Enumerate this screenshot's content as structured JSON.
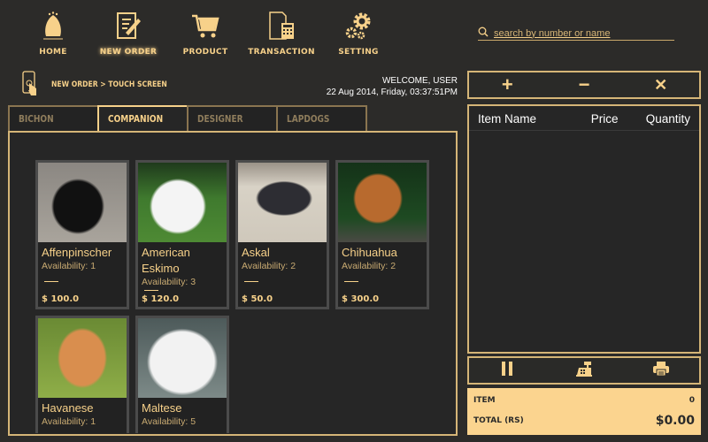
{
  "nav": [
    {
      "label": "HOME",
      "icon": "home-icon"
    },
    {
      "label": "NEW ORDER",
      "icon": "new-order-icon"
    },
    {
      "label": "PRODUCT",
      "icon": "cart-icon"
    },
    {
      "label": "TRANSACTION",
      "icon": "calculator-icon"
    },
    {
      "label": "SETTING",
      "icon": "gear-icon"
    }
  ],
  "search": {
    "placeholder": "search by number or name"
  },
  "breadcrumb": "NEW ORDER > TOUCH SCREEN",
  "welcome": "WELCOME, USER",
  "datetime": "22 Aug 2014, Friday, 03:37:51PM",
  "tabs": [
    "BICHON",
    "COMPANION",
    "DESIGNER",
    "LAPDOGS"
  ],
  "products": [
    {
      "name": "Affenpinscher",
      "availability": "Availability: 1",
      "price": "$  100.0"
    },
    {
      "name": "American Eskimo",
      "availability": "Availability: 3",
      "price": "$  120.0"
    },
    {
      "name": "Askal",
      "availability": "Availability: 2",
      "price": "$  50.0"
    },
    {
      "name": "Chihuahua",
      "availability": "Availability: 2",
      "price": "$  300.0"
    },
    {
      "name": "Havanese",
      "availability": "Availability: 1",
      "price": ""
    },
    {
      "name": "Maltese",
      "availability": "Availability: 5",
      "price": ""
    }
  ],
  "cart": {
    "plus": "+",
    "minus": "−",
    "remove": "✕",
    "columns": [
      "Item Name",
      "Price",
      "Quantity"
    ]
  },
  "summary": {
    "item_label": "ITEM",
    "item_value": "0",
    "total_label": "TOTAL (RS)",
    "total_value": "$0.00"
  },
  "colors": {
    "accent": "#f7d18a",
    "bg": "#2c2b29"
  }
}
